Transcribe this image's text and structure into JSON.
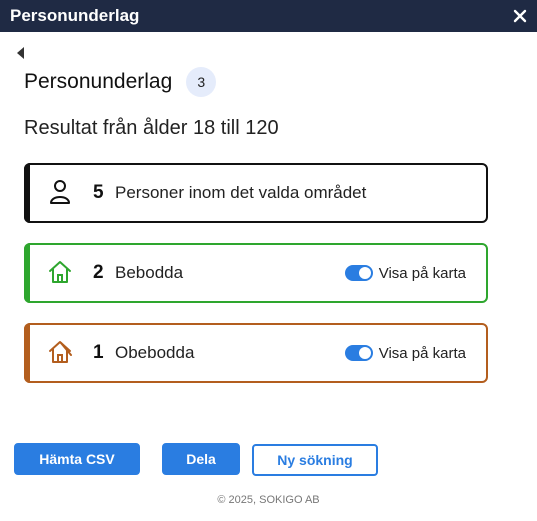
{
  "window": {
    "title": "Personunderlag",
    "close_icon": "close-icon"
  },
  "heading": {
    "title": "Personunderlag",
    "badge": "3"
  },
  "result_text": "Resultat från ålder 18 till 120",
  "cards": {
    "persons": {
      "count": "5",
      "label": "Personer inom det valda området",
      "icon": "person-icon",
      "color": "#111111"
    },
    "occupied": {
      "count": "2",
      "label": "Bebodda",
      "icon": "house-icon",
      "color": "#2ea62e",
      "toggle_label": "Visa på karta",
      "toggle_on": true
    },
    "unoccupied": {
      "count": "1",
      "label": "Obebodda",
      "icon": "house-crossed-icon",
      "color": "#b35e1e",
      "toggle_label": "Visa på karta",
      "toggle_on": true
    }
  },
  "buttons": {
    "csv": "Hämta CSV",
    "share": "Dela",
    "new_search": "Ny sökning"
  },
  "footer": "© 2025, SOKIGO AB",
  "colors": {
    "titlebar": "#1f2a44",
    "primary": "#2a7de1"
  }
}
